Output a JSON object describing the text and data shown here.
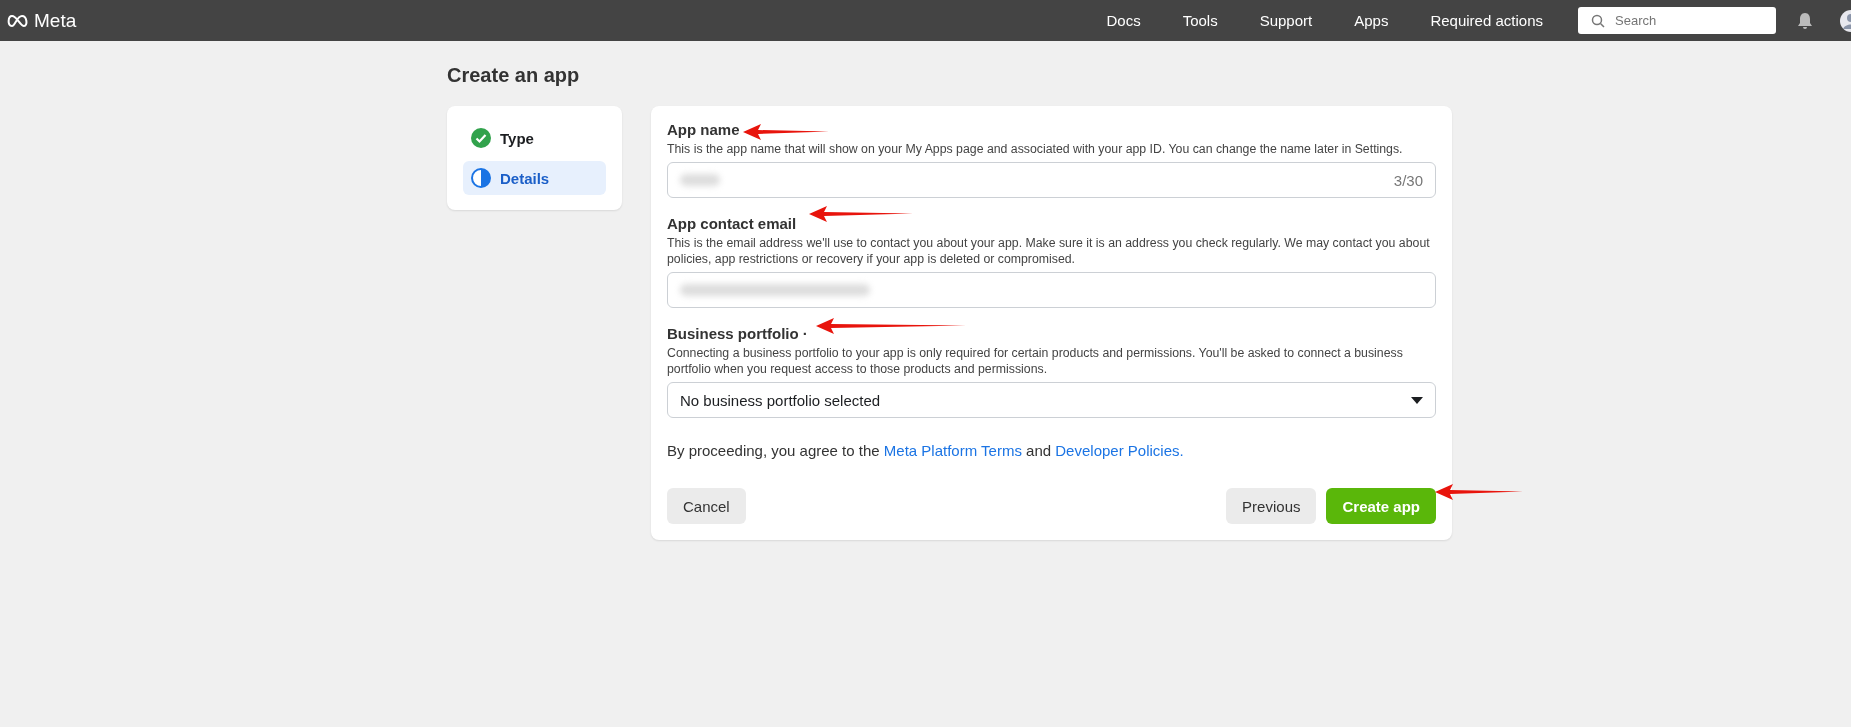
{
  "topbar": {
    "logo": "Meta",
    "nav": [
      {
        "label": "Docs"
      },
      {
        "label": "Tools"
      },
      {
        "label": "Support"
      },
      {
        "label": "Apps"
      },
      {
        "label": "Required actions"
      }
    ],
    "search": {
      "placeholder": "Search"
    }
  },
  "page_title": "Create an app",
  "steps": [
    {
      "label": "Type",
      "kind": "done",
      "selected": false
    },
    {
      "label": "Details",
      "kind": "current",
      "selected": true
    }
  ],
  "form": {
    "fields": [
      {
        "kind": "text",
        "label": "App name",
        "help": "This is the app name that will show on your My Apps page and associated with your app ID. You can change the name later in Settings.",
        "redacted": true,
        "counter": "3/30"
      },
      {
        "kind": "text",
        "label": "App contact email",
        "help": "This is the email address we'll use to contact you about your app. Make sure it is an address you check regularly. We may contact you about policies, app restrictions or recovery if your app is deleted or compromised.",
        "redacted": true
      },
      {
        "kind": "select",
        "label": "Business portfolio ·",
        "help": "Connecting a business portfolio to your app is only required for certain products and permissions. You'll be asked to connect a business portfolio when you request access to those products and permissions.",
        "value": "No business portfolio selected"
      }
    ],
    "agreement": {
      "before": "By proceeding, you agree to the ",
      "link1": "Meta Platform Terms",
      "middle": " and ",
      "link2": "Developer Policies."
    },
    "left_buttons": [
      {
        "label": "Cancel",
        "kind": "secondary"
      }
    ],
    "right_buttons": [
      {
        "label": "Previous",
        "kind": "secondary"
      },
      {
        "label": "Create app",
        "kind": "primary"
      }
    ]
  }
}
